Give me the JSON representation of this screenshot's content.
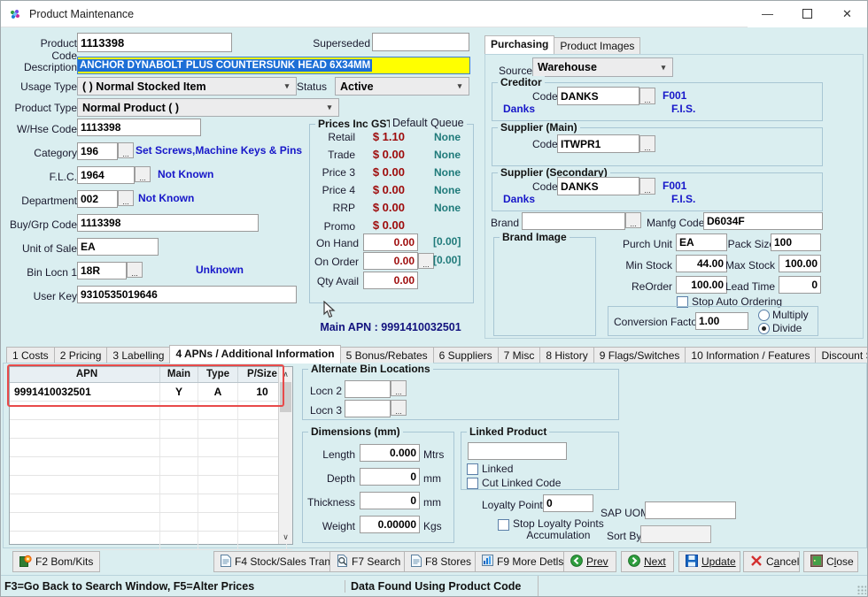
{
  "window": {
    "title": "Product Maintenance",
    "icon": "pinwheel-icon",
    "minimize": "—",
    "maximize": "☐",
    "close": "✕"
  },
  "left": {
    "product_code_label": "Product Code",
    "product_code_value": "1113398",
    "superseded_label": "Superseded",
    "superseded_value": "",
    "description_label": "Description",
    "description_value": "ANCHOR DYNABOLT PLUS COUNTERSUNK HEAD 6X34MM",
    "usage_type_label": "Usage Type",
    "usage_type_value": "( ) Normal Stocked Item",
    "status_label": "Status",
    "status_value": "Active",
    "product_type_label": "Product Type",
    "product_type_value": "Normal Product ( )",
    "whse_code_label": "W/Hse Code",
    "whse_code_value": "1113398",
    "category_label": "Category",
    "category_value": "196",
    "category_desc": "Set Screws,Machine Keys & Pins",
    "flc_label": "F.L.C.",
    "flc_value": "1964",
    "flc_desc": "Not Known",
    "department_label": "Department",
    "department_value": "002",
    "department_desc": "Not Known",
    "buygrp_label": "Buy/Grp Code",
    "buygrp_value": "1113398",
    "unit_of_sale_label": "Unit of Sale",
    "unit_of_sale_value": "EA",
    "bin_locn_label": "Bin Locn 1",
    "bin_locn_value": "18R",
    "bin_locn_desc": "Unknown",
    "user_key_label": "User Key",
    "user_key_value": "9310535019646",
    "ellipsis": "..."
  },
  "prices": {
    "group_title": "Prices Inc GST",
    "queue_title": "Default Queue",
    "rows": [
      {
        "label": "Retail",
        "value": "$ 1.10",
        "queue": "None"
      },
      {
        "label": "Trade",
        "value": "$ 0.00",
        "queue": "None"
      },
      {
        "label": "Price 3",
        "value": "$ 0.00",
        "queue": "None"
      },
      {
        "label": "Price 4",
        "value": "$ 0.00",
        "queue": "None"
      },
      {
        "label": "RRP",
        "value": "$ 0.00",
        "queue": "None"
      },
      {
        "label": "Promo",
        "value": "$ 0.00",
        "queue": ""
      }
    ],
    "on_hand_label": "On Hand",
    "on_hand_value": "0.00",
    "on_hand_alt": "[0.00]",
    "on_order_label": "On Order",
    "on_order_value": "0.00",
    "on_order_alt": "[0.00]",
    "on_order_ellipsis": "...",
    "qty_avail_label": "Qty Avail",
    "qty_avail_value": "0.00",
    "main_apn_text": "Main APN : 9991410032501"
  },
  "right": {
    "tabs": [
      {
        "label": "Purchasing",
        "selected": true
      },
      {
        "label": "Product Images",
        "selected": false
      }
    ],
    "source_label": "Source",
    "source_value": "Warehouse",
    "creditor": {
      "title": "Creditor",
      "code_label": "Code",
      "code_value": "DANKS",
      "ellipsis": "...",
      "right_code": "F001",
      "name": "Danks",
      "terms": "F.I.S."
    },
    "supplier_main": {
      "title": "Supplier (Main)",
      "code_label": "Code",
      "code_value": "ITWPR1",
      "ellipsis": "...",
      "right_code": "",
      "name": "",
      "terms": ""
    },
    "supplier_secondary": {
      "title": "Supplier (Secondary)",
      "code_label": "Code",
      "code_value": "DANKS",
      "ellipsis": "...",
      "right_code": "F001",
      "name": "Danks",
      "terms": "F.I.S."
    },
    "brand_label": "Brand",
    "brand_value": "",
    "brand_ellipsis": "...",
    "manfg_label": "Manfg Code",
    "manfg_value": "D6034F",
    "brand_image_title": "Brand Image",
    "purch_unit_label": "Purch Unit",
    "purch_unit_value": "EA",
    "pack_size_label": "Pack Size",
    "pack_size_value": "100",
    "min_stock_label": "Min Stock",
    "min_stock_value": "44.00",
    "max_stock_label": "Max Stock",
    "max_stock_value": "100.00",
    "reorder_label": "ReOrder",
    "reorder_value": "100.00",
    "lead_time_label": "Lead Time",
    "lead_time_value": "0",
    "stop_auto_label": "Stop Auto Ordering",
    "conv_factor_label": "Conversion Factor",
    "conv_factor_value": "1.00",
    "multiply_label": "Multiply",
    "divide_label": "Divide"
  },
  "main_tabs": [
    {
      "label": "1 Costs",
      "selected": false
    },
    {
      "label": "2 Pricing",
      "selected": false
    },
    {
      "label": "3 Labelling",
      "selected": false
    },
    {
      "label": "4 APNs / Additional Information",
      "selected": true
    },
    {
      "label": "5 Bonus/Rebates",
      "selected": false
    },
    {
      "label": "6 Suppliers",
      "selected": false
    },
    {
      "label": "7 Misc",
      "selected": false
    },
    {
      "label": "8 History",
      "selected": false
    },
    {
      "label": "9 Flags/Switches",
      "selected": false
    },
    {
      "label": "10 Information / Features",
      "selected": false
    },
    {
      "label": "Discount Structures",
      "selected": false
    }
  ],
  "apn_grid": {
    "columns": [
      "APN",
      "Main",
      "Type",
      "P/Size"
    ],
    "rows": [
      {
        "apn": "9991410032501",
        "main": "Y",
        "type": "A",
        "psize": "10"
      }
    ],
    "scroll_up": "∧",
    "scroll_down": "∨"
  },
  "alt_bin": {
    "title": "Alternate Bin Locations",
    "locn2_label": "Locn 2",
    "locn2_value": "",
    "locn3_label": "Locn 3",
    "locn3_value": "",
    "ellipsis": "..."
  },
  "dimensions": {
    "title": "Dimensions (mm)",
    "rows": [
      {
        "label": "Length",
        "value": "0.000",
        "unit": "Mtrs"
      },
      {
        "label": "Depth",
        "value": "0",
        "unit": "mm"
      },
      {
        "label": "Thickness",
        "value": "0",
        "unit": "mm"
      },
      {
        "label": "Weight",
        "value": "0.00000",
        "unit": "Kgs"
      }
    ]
  },
  "linked": {
    "title": "Linked Product",
    "code_value": "",
    "linked_label": "Linked",
    "cut_linked_label": "Cut Linked Code"
  },
  "loyalty": {
    "points_label": "Loyalty Points",
    "points_value": "0",
    "stop_label_1": "Stop Loyalty Points",
    "stop_label_2": "Accumulation",
    "sap_uom_label": "SAP UOM",
    "sap_uom_value": "",
    "sort_by_label": "Sort By",
    "sort_by_value": ""
  },
  "buttons": {
    "bom_kits": "F2 Bom/Kits",
    "stock_sales": "F4 Stock/Sales Trans",
    "search": "F7 Search",
    "stores": "F8 Stores",
    "more_detls": "F9 More Detls",
    "prev": "Prev",
    "next": "Next",
    "update": "Update",
    "cancel": "Cancel",
    "close": "Close"
  },
  "statusbar": {
    "hint": "F3=Go Back to Search Window, F5=Alter Prices",
    "message": "Data Found Using Product Code"
  },
  "colors": {
    "background": "#daeef0",
    "highlight_yellow": "#ffff00",
    "selection_blue": "#1d6fd6",
    "link_blue": "#1717c9",
    "price_red": "#9e0b0b",
    "queue_teal": "#1f7a7a",
    "apn_highlight": "#e84a4a"
  }
}
